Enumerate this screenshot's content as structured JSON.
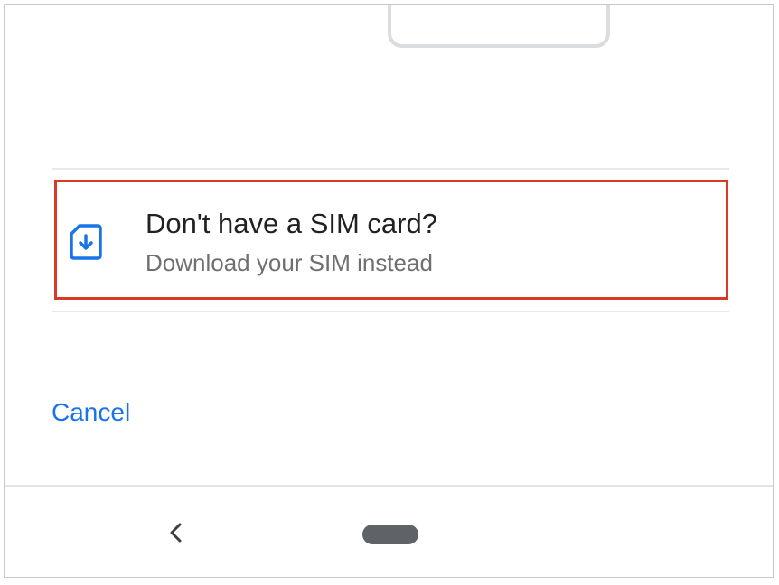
{
  "esim_option": {
    "title": "Don't have a SIM card?",
    "subtitle": "Download your SIM instead",
    "icon": "sim-download-icon"
  },
  "actions": {
    "cancel_label": "Cancel"
  },
  "navigation": {
    "back_icon": "back-chevron-icon",
    "home_icon": "home-pill-icon"
  },
  "colors": {
    "accent": "#1a73e8",
    "highlight": "#d93a26",
    "title_text": "#202124",
    "subtitle_text": "#6f6f6f"
  }
}
